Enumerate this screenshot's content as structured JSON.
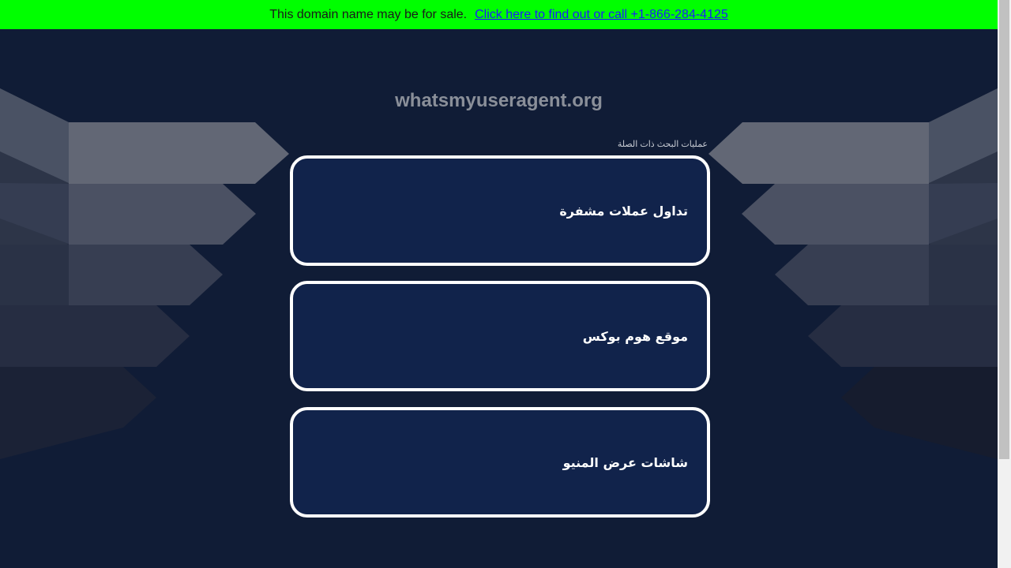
{
  "banner": {
    "text": "This domain name may be for sale.",
    "link": "Click here to find out or call +1-866-284-4125",
    "background": "#00ff00"
  },
  "site": {
    "title": "whatsmyuseragent.org"
  },
  "related": {
    "label": "عمليات البحث ذات الصلة",
    "items": [
      {
        "label": "تداول عملات مشفرة"
      },
      {
        "label": "موقع هوم بوكس"
      },
      {
        "label": "شاشات عرض المنيو"
      }
    ]
  },
  "colors": {
    "page_background": "#101c36",
    "box_background": "#11234b",
    "box_border": "#ffffff",
    "title": "#8a8f99"
  }
}
